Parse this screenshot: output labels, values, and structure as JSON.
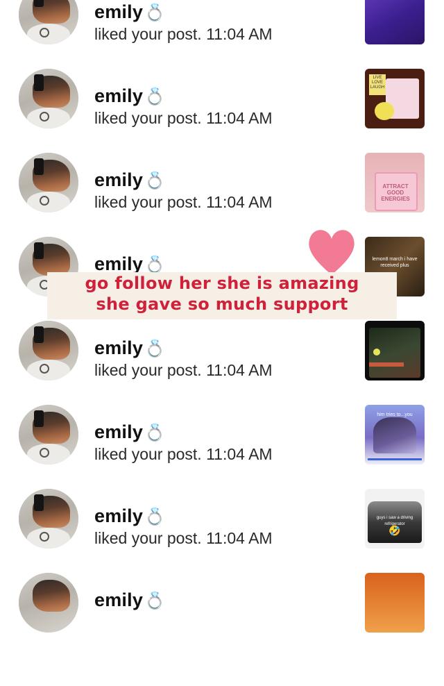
{
  "notifications": [
    {
      "username": "emily",
      "badge": "💍",
      "message": "liked your post.",
      "time": "11:04 AM",
      "thumb_caption": ""
    },
    {
      "username": "emily",
      "badge": "💍",
      "message": "liked your post.",
      "time": "11:04 AM",
      "thumb_caption": "LIVE LOVE LAUGH"
    },
    {
      "username": "emily",
      "badge": "💍",
      "message": "liked your post.",
      "time": "11:04 AM",
      "thumb_caption": "ATTRACT GOOD ENERGIES"
    },
    {
      "username": "emily",
      "badge": "💍",
      "message": "",
      "time": "",
      "thumb_caption": "lemon8 march i have received plus"
    },
    {
      "username": "emily",
      "badge": "💍",
      "message": "liked your post.",
      "time": "11:04 AM",
      "thumb_caption": ""
    },
    {
      "username": "emily",
      "badge": "💍",
      "message": "liked your post.",
      "time": "11:04 AM",
      "thumb_caption": "him tries to...you"
    },
    {
      "username": "emily",
      "badge": "💍",
      "message": "liked your post.",
      "time": "11:04 AM",
      "thumb_caption": "guys i saw a driving refrigerator"
    },
    {
      "username": "emily",
      "badge": "💍",
      "message": "",
      "time": "",
      "thumb_caption": ""
    }
  ],
  "overlay": {
    "line1": "go follow her she is amazing",
    "line2": "she gave so much support",
    "text_color": "#d0213a",
    "heart_color": "#f27a95"
  }
}
